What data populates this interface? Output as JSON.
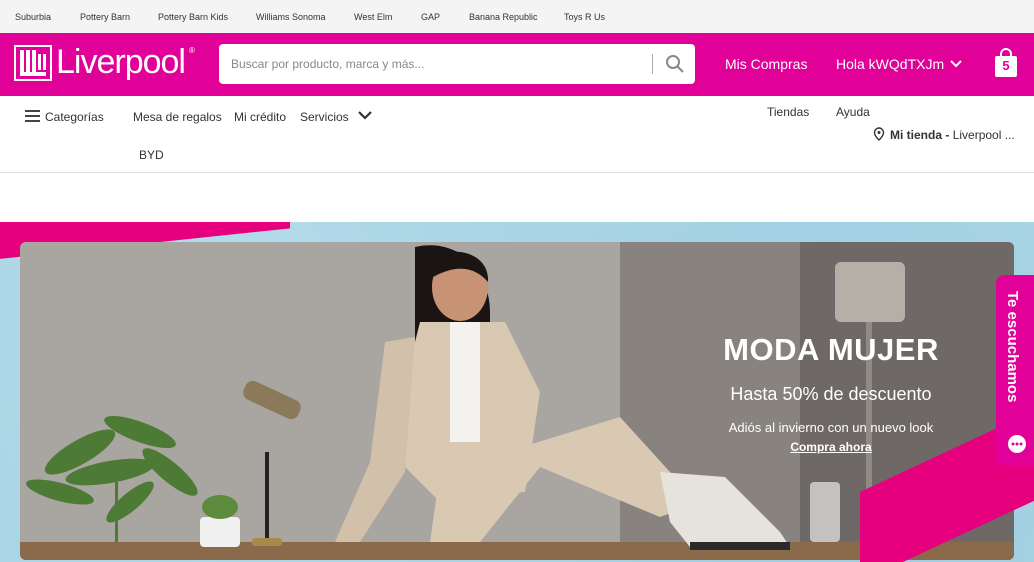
{
  "partners": [
    "Suburbia",
    "Pottery Barn",
    "Pottery Barn Kids",
    "Williams Sonoma",
    "West Elm",
    "GAP",
    "Banana Republic",
    "Toys R Us"
  ],
  "header": {
    "logo_text": "Liverpool",
    "logo_reg": "®",
    "search_placeholder": "Buscar por producto, marca y más...",
    "mis_compras": "Mis Compras",
    "greeting": "Hola kWQdTXJm",
    "bag_count": "5"
  },
  "nav": {
    "categorias": "Categorías",
    "mesa_regalos": "Mesa de regalos",
    "mi_credito": "Mi crédito",
    "servicios": "Servicios",
    "byd": "BYD",
    "tiendas": "Tiendas",
    "ayuda": "Ayuda",
    "mi_tienda_label": "Mi tienda -",
    "mi_tienda_value": "Liverpool ..."
  },
  "banner": {
    "title": "MODA MUJER",
    "subtitle": "Hasta 50% de descuento",
    "small": "Adiós al invierno con un nuevo look",
    "cta": "Compra ahora"
  },
  "feedback": {
    "label": "Te escuchamos"
  },
  "colors": {
    "brand_pink": "#e10098",
    "stripe_pink": "#e6007e",
    "banner_bg": "#a8d4e4"
  }
}
